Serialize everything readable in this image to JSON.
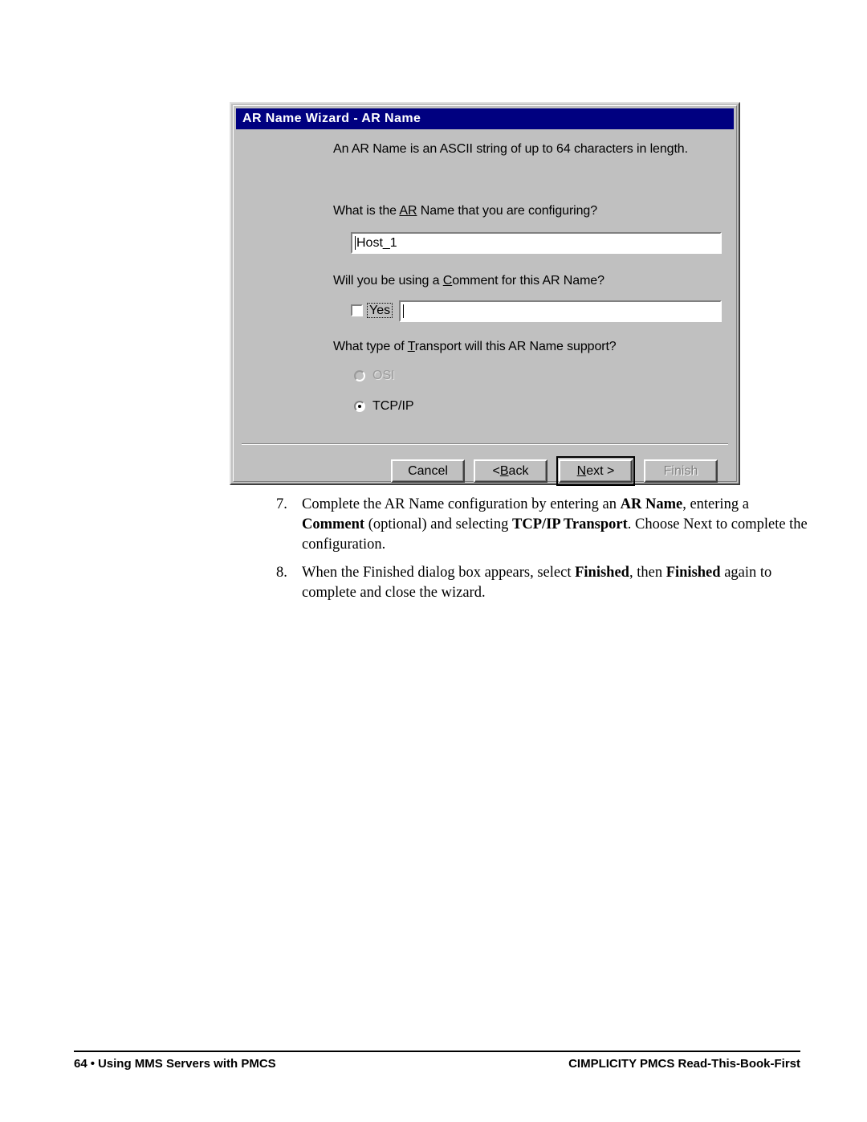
{
  "dialog": {
    "title": "AR Name Wizard - AR Name",
    "intro_text": "An AR Name is an ASCII string of up to 64 characters in length.",
    "arname_question_pre": "What is the ",
    "arname_question_accel": "AR",
    "arname_question_post": " Name that you are configuring?",
    "arname_value": "Host_1",
    "comment_question_pre": "Will you be using a ",
    "comment_question_accel": "C",
    "comment_question_post": "omment for this AR Name?",
    "comment_checkbox_label": "Yes",
    "comment_checkbox_checked": false,
    "comment_value": "",
    "transport_question_pre": "What type of ",
    "transport_question_accel": "T",
    "transport_question_post": "ransport will this AR Name support?",
    "radio_osi_label": "OSI",
    "radio_osi_selected": false,
    "radio_osi_disabled": true,
    "radio_tcpip_label": "TCP/IP",
    "radio_tcpip_selected": true,
    "buttons": {
      "cancel": "Cancel",
      "back_pre": "< ",
      "back_accel": "B",
      "back_post": "ack",
      "next_accel": "N",
      "next_post": "ext >",
      "finish": "Finish"
    },
    "colors": {
      "titlebar": "#000080",
      "face": "#c0c0c0",
      "field": "#ffffff",
      "disabled_text": "#808080"
    }
  },
  "document": {
    "steps": [
      {
        "number": "7.",
        "segments": [
          {
            "text": "Complete the AR Name configuration by entering an ",
            "bold": false
          },
          {
            "text": "AR Name",
            "bold": true
          },
          {
            "text": ", entering a ",
            "bold": false
          },
          {
            "text": "Comment",
            "bold": true
          },
          {
            "text": " (optional) and selecting ",
            "bold": false
          },
          {
            "text": "TCP/IP Transport",
            "bold": true
          },
          {
            "text": ". Choose Next to complete the configuration.",
            "bold": false
          }
        ]
      },
      {
        "number": "8.",
        "segments": [
          {
            "text": "When the Finished dialog box appears, select ",
            "bold": false
          },
          {
            "text": "Finished",
            "bold": true
          },
          {
            "text": ", then ",
            "bold": false
          },
          {
            "text": "Finished",
            "bold": true
          },
          {
            "text": " again to complete and close the wizard.",
            "bold": false
          }
        ]
      }
    ]
  },
  "footer": {
    "page_number": "64",
    "bullet": "•",
    "left_title": "Using MMS Servers with PMCS",
    "right_title": "CIMPLICITY PMCS Read-This-Book-First"
  }
}
